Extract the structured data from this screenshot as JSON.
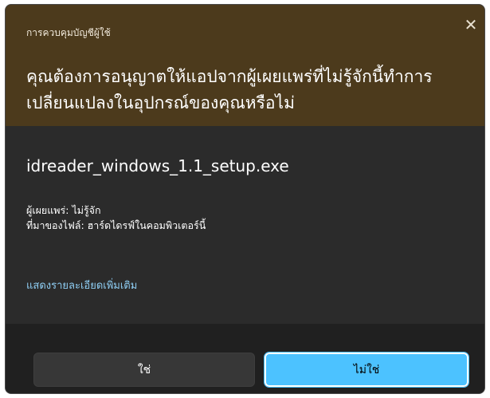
{
  "dialog": {
    "header_title": "การควบคุมบัญชีผู้ใช้",
    "close_glyph": "✕",
    "question": "คุณต้องการอนุญาตให้แอปจากผู้เผยแพร่ที่ไม่รู้จักนี้ทำการเปลี่ยนแปลงในอุปกรณ์ของคุณหรือไม่",
    "filename": "idreader_windows_1.1_setup.exe",
    "publisher": "ผู้เผยแพร่: ไม่รู้จัก",
    "file_origin": "ที่มาของไฟล์: ฮาร์ดไดรฟ์ในคอมพิวเตอร์นี้",
    "more_details": "แสดงรายละเอียดเพิ่มเติม",
    "yes_label": "ใช่",
    "no_label": "ไม่ใช่"
  },
  "colors": {
    "header_bg": "#4c3a1c",
    "body_bg": "#2b2b2b",
    "footer_bg": "#202020",
    "link": "#8ecdf3",
    "primary_button": "#4cc2ff"
  },
  "icons": {
    "close": "close-icon"
  }
}
